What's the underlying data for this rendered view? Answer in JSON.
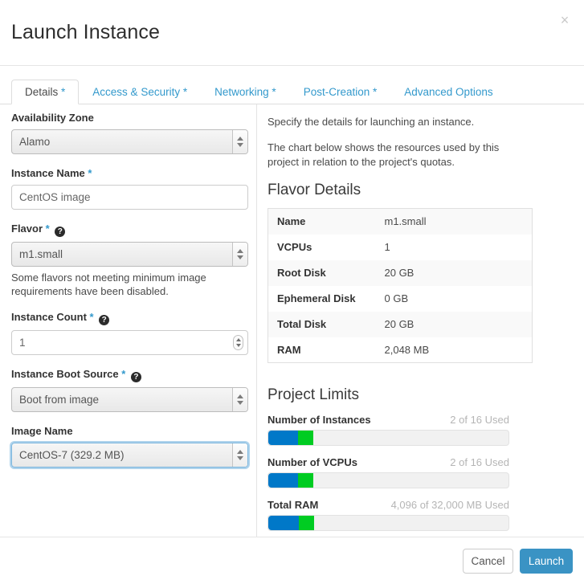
{
  "modal": {
    "title": "Launch Instance",
    "close_label": "×"
  },
  "tabs": [
    {
      "label": "Details",
      "required": "*",
      "active": true
    },
    {
      "label": "Access & Security",
      "required": "*",
      "active": false
    },
    {
      "label": "Networking",
      "required": "*",
      "active": false
    },
    {
      "label": "Post-Creation",
      "required": "*",
      "active": false
    },
    {
      "label": "Advanced Options",
      "required": "",
      "active": false
    }
  ],
  "form": {
    "availability_zone": {
      "label": "Availability Zone",
      "value": "Alamo"
    },
    "instance_name": {
      "label": "Instance Name",
      "required": "*",
      "value": "CentOS image",
      "placeholder": ""
    },
    "flavor": {
      "label": "Flavor",
      "required": "*",
      "help": "?",
      "value": "m1.small",
      "hint": "Some flavors not meeting minimum image requirements have been disabled."
    },
    "instance_count": {
      "label": "Instance Count",
      "required": "*",
      "help": "?",
      "value": "1"
    },
    "instance_boot_source": {
      "label": "Instance Boot Source",
      "required": "*",
      "help": "?",
      "value": "Boot from image"
    },
    "image_name": {
      "label": "Image Name",
      "value": "CentOS-7 (329.2 MB)",
      "focused": true
    }
  },
  "info": {
    "paragraph_1": "Specify the details for launching an instance.",
    "paragraph_2": "The chart below shows the resources used by this project in relation to the project's quotas.",
    "flavor_details_title": "Flavor Details",
    "project_limits_title": "Project Limits"
  },
  "flavor_details": {
    "rows": [
      {
        "name": "Name",
        "value": "m1.small"
      },
      {
        "name": "VCPUs",
        "value": "1"
      },
      {
        "name": "Root Disk",
        "value": "20 GB"
      },
      {
        "name": "Ephemeral Disk",
        "value": "0 GB"
      },
      {
        "name": "Total Disk",
        "value": "20 GB"
      },
      {
        "name": "RAM",
        "value": "2,048 MB"
      }
    ]
  },
  "chart_data": {
    "type": "bar",
    "title": "Project Limits",
    "orientation": "horizontal",
    "categories": [
      "Number of Instances",
      "Number of VCPUs",
      "Total RAM"
    ],
    "series": [
      {
        "name": "Used",
        "color": "#0078c8",
        "values": [
          2,
          2,
          4096
        ]
      },
      {
        "name": "Added",
        "color": "#00cc22",
        "values": [
          1,
          1,
          2048
        ]
      }
    ],
    "maximums": [
      16,
      16,
      32000
    ],
    "units": [
      "",
      "",
      "MB"
    ],
    "labels": [
      "2 of 16 Used",
      "2 of 16 Used",
      "4,096 of 32,000 MB Used"
    ],
    "used_percent": [
      12.5,
      12.5,
      12.8
    ],
    "added_percent": [
      6.25,
      6.25,
      6.4
    ],
    "grid": false,
    "legend": "none"
  },
  "project_limits": [
    {
      "name": "Number of Instances",
      "used_text": "2 of 16 Used",
      "used_pct": "12.5%",
      "added_left": "12.5%",
      "added_pct": "6.25%"
    },
    {
      "name": "Number of VCPUs",
      "used_text": "2 of 16 Used",
      "used_pct": "12.5%",
      "added_left": "12.5%",
      "added_pct": "6.25%"
    },
    {
      "name": "Total RAM",
      "used_text": "4,096 of 32,000 MB Used",
      "used_pct": "12.8%",
      "added_left": "12.8%",
      "added_pct": "6.4%"
    }
  ],
  "footer": {
    "cancel_label": "Cancel",
    "launch_label": "Launch"
  },
  "colors": {
    "accent": "#3a93c4",
    "link": "#3399cc",
    "bar_used": "#0078c8",
    "bar_added": "#00cc22"
  }
}
